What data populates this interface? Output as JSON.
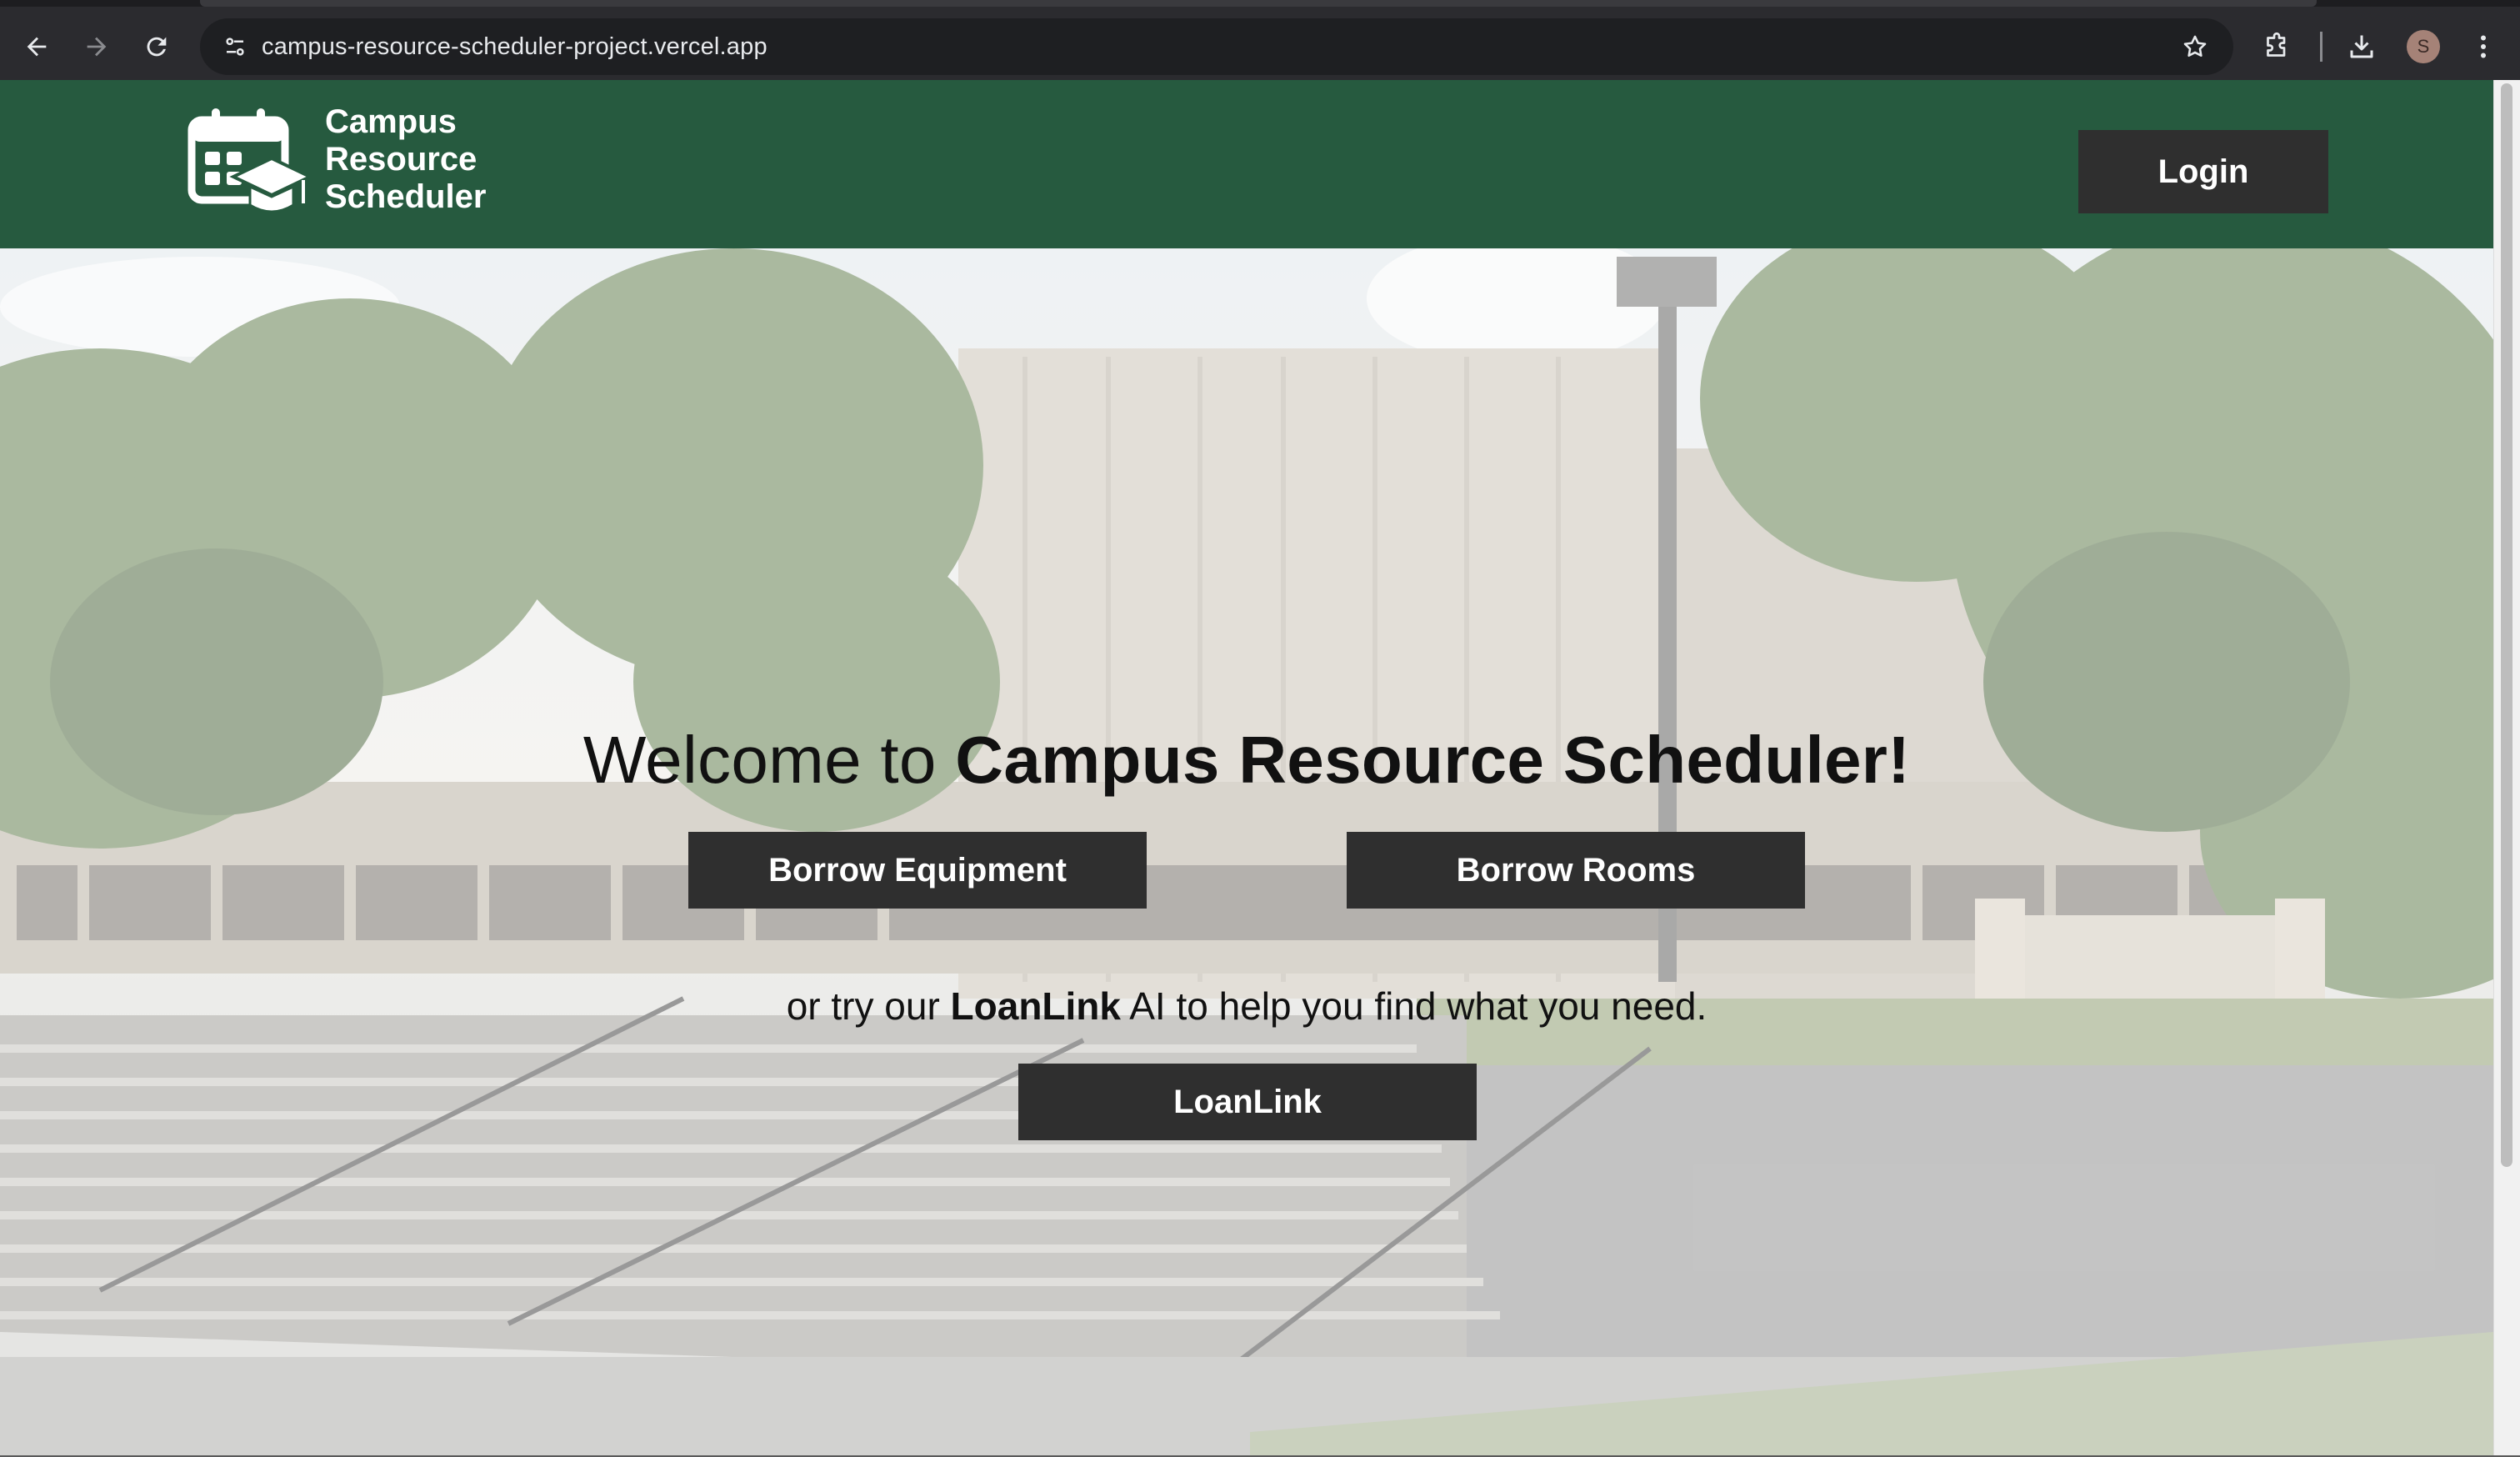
{
  "browser": {
    "url": "campus-resource-scheduler-project.vercel.app",
    "profile_initial": "S",
    "icons": [
      "back-icon",
      "forward-icon",
      "reload-icon",
      "site-info-icon",
      "bookmark-star-icon",
      "extensions-icon",
      "downloads-icon",
      "more-vert-icon"
    ]
  },
  "header": {
    "logo_lines": [
      "Campus",
      "Resource",
      "Scheduler"
    ],
    "login_label": "Login",
    "background_color": "#265a3f"
  },
  "hero": {
    "welcome_prefix": "Welcome to ",
    "welcome_app_name": "Campus Resource Scheduler!",
    "borrow_equipment_label": "Borrow Equipment",
    "borrow_rooms_label": "Borrow Rooms",
    "subtext_prefix": "or try our ",
    "subtext_brand": "LoanLink",
    "subtext_suffix": " AI to help you find what you need.",
    "loanlink_label": "LoanLink",
    "button_color": "#2f2f2f"
  }
}
